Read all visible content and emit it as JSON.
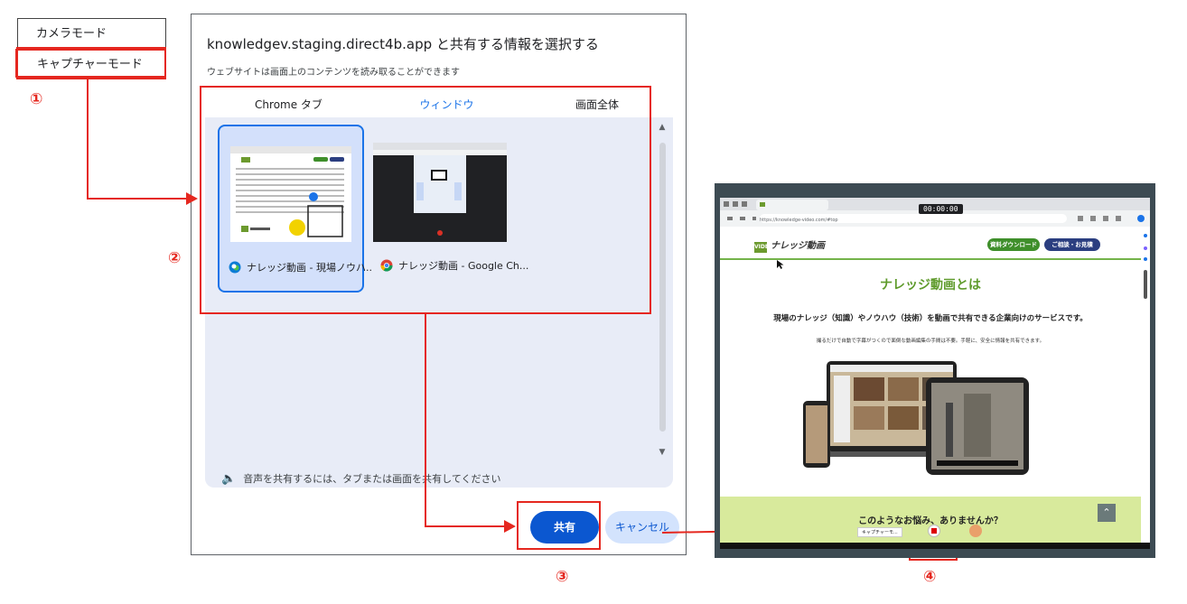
{
  "mode_menu": {
    "camera_mode": "カメラモード",
    "capture_mode": "キャプチャーモード"
  },
  "steps": [
    "①",
    "②",
    "③",
    "④"
  ],
  "dialog": {
    "title": "knowledgev.staging.direct4b.app と共有する情報を選択する",
    "subtitle": "ウェブサイトは画面上のコンテンツを読み取ることができます",
    "tabs": [
      "Chrome タブ",
      "ウィンドウ",
      "画面全体"
    ],
    "active_tab": "ウィンドウ",
    "windows": [
      {
        "label": "ナレッジ動画 - 現場ノウハ...",
        "icon": "edge-icon",
        "selected": true
      },
      {
        "label": "ナレッジ動画 - Google Ch...",
        "icon": "chrome-icon",
        "selected": false
      }
    ],
    "audio_note": "音声を共有するには、タブまたは画面を共有してください",
    "share_label": "共有",
    "cancel_label": "キャンセル"
  },
  "captured_page": {
    "timer": "00:00:00",
    "address": "https://knowledge-video.com/#top",
    "logo_badge": "VIDEO",
    "logo_text": "ナレッジ動画",
    "download_button": "資料ダウンロード",
    "contact_button": "ご相談・お見積",
    "hero_title": "ナレッジ動画とは",
    "hero_subtitle": "現場のナレッジ（知識）やノウハウ（技術）を動画で共有できる企業向けのサービスです。",
    "hero_small": "撮るだけで自動で字幕がつくので面倒な動画編集の手間は不要。手軽に、安全に情報を共有できます。",
    "band_text": "このようなお悩み、ありませんか？",
    "mini_select": "キャプチャーモ..."
  },
  "colors": {
    "annotation_red": "#e5271f",
    "google_blue": "#0b57d0",
    "site_green": "#5f9b2c"
  }
}
